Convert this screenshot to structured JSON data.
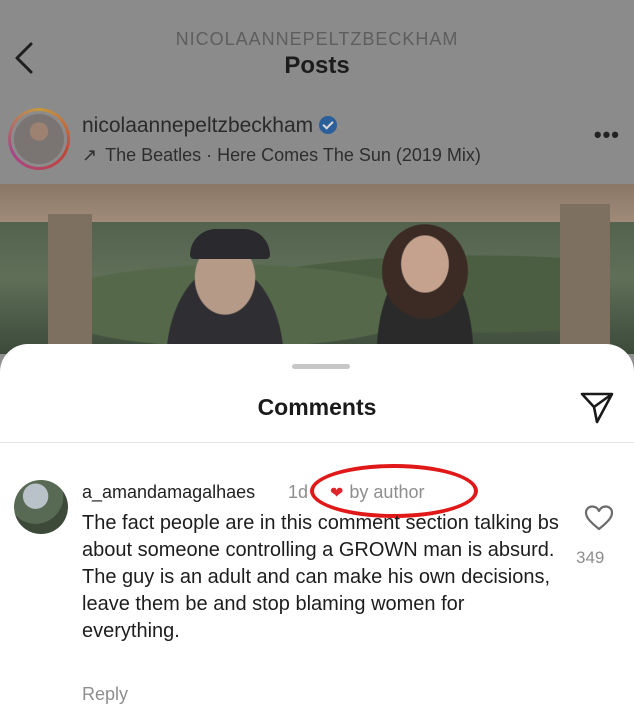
{
  "header": {
    "account_caps": "NICOLAANNEPELTZBECKHAM",
    "title": "Posts",
    "back_icon": "chevron-left-icon"
  },
  "post": {
    "author": "nicolaannepeltzbeckham",
    "verified": true,
    "music_arrow": "↗",
    "music": "The Beatles · Here Comes The Sun (2019 Mix)",
    "more": "•••"
  },
  "comments": {
    "title": "Comments",
    "share_icon": "send-icon",
    "items": [
      {
        "username": "a_amandamagalhaes",
        "time": "1d",
        "liked_by_author": "by author",
        "text": "The fact people are in this comment section talking bs about someone controlling a GROWN man is absurd. The guy is an adult and can make his own decisions, leave them be and stop blaming women for everything.",
        "likes": "349",
        "reply": "Reply"
      }
    ]
  },
  "colors": {
    "annotation_red": "#e01818",
    "heart_red": "#e0242c",
    "muted_text": "#8e8e8e"
  }
}
